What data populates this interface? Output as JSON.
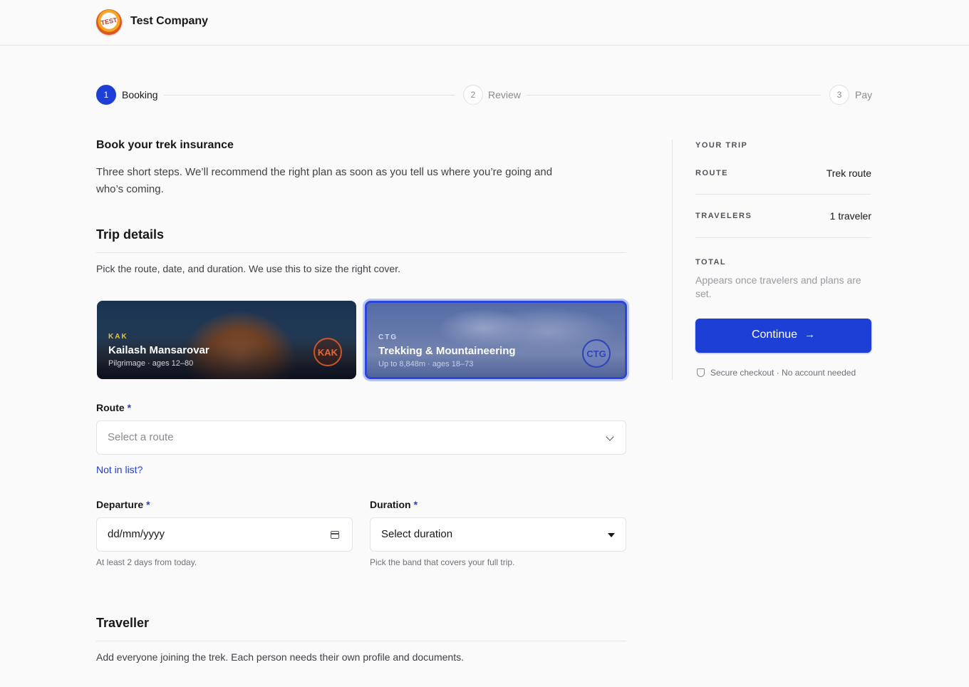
{
  "header": {
    "logo_text": "TEST",
    "company": "Test Company"
  },
  "stepper": [
    {
      "num": "1",
      "label": "Booking",
      "state": "active"
    },
    {
      "num": "2",
      "label": "Review",
      "state": "idle"
    },
    {
      "num": "3",
      "label": "Pay",
      "state": "idle"
    }
  ],
  "page": {
    "title": "Book your trek insurance",
    "intro": "Three short steps. We’ll recommend the right plan as soon as you tell us where you’re going and who’s coming."
  },
  "trip": {
    "title": "Trip details",
    "desc": "Pick the route, date, and duration. We use this to size the right cover.",
    "cards": [
      {
        "code": "KAK",
        "title": "Kailash Mansarovar",
        "sub": "Pilgrimage · ages 12–80",
        "badge": "KAK",
        "selected": false
      },
      {
        "code": "CTG",
        "title": "Trekking & Mountaineering",
        "sub": "Up to 8,848m · ages 18–73",
        "badge": "CTG",
        "selected": true
      }
    ],
    "route_label": "Route",
    "route_placeholder": "Select a route",
    "not_in_list": "Not in list?",
    "departure_label": "Departure",
    "departure_value": "dd/mm/yyyy",
    "departure_hint": "At least 2 days from today.",
    "duration_label": "Duration",
    "duration_value": "Select duration",
    "duration_hint": "Pick the band that covers your full trip.",
    "required_mark": "*"
  },
  "traveller": {
    "title": "Traveller",
    "desc": "Add everyone joining the trek. Each person needs their own profile and documents."
  },
  "sidebar": {
    "heading": "YOUR TRIP",
    "route_cap": "ROUTE",
    "route_val": "Trek route",
    "travelers_cap": "TRAVELERS",
    "travelers_val": "1 traveler",
    "total_cap": "TOTAL",
    "total_note": "Appears once travelers and plans are set.",
    "continue": "Continue",
    "secure": "Secure checkout · No account needed"
  },
  "colors": {
    "accent": "#1d3fd6",
    "border": "#e4e4e7",
    "background": "#fafafa"
  }
}
